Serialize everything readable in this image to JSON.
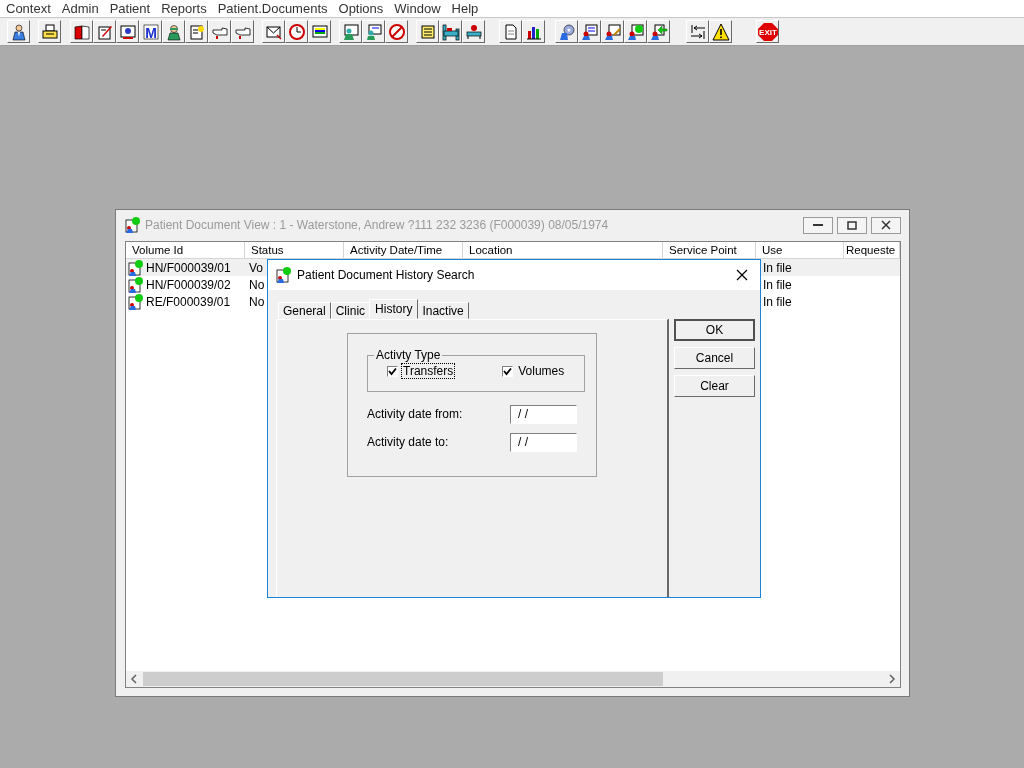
{
  "menu": [
    {
      "label": "Context"
    },
    {
      "label": "Admin"
    },
    {
      "label": "Patient"
    },
    {
      "label": "Reports"
    },
    {
      "label": "Patient.Documents"
    },
    {
      "label": "Options"
    },
    {
      "label": "Window"
    },
    {
      "label": "Help"
    }
  ],
  "toolbar": {
    "letter_label": "M",
    "exit_label": "EXIT"
  },
  "document_window": {
    "title": "Patient Document View : 1 - Waterstone, Andrew ?111 232 3236 (F000039) 08/05/1974",
    "columns": [
      "Volume Id",
      "Status",
      "Activity Date/Time",
      "Location",
      "Service Point",
      "Use",
      "Requeste"
    ],
    "rows": [
      {
        "volume_id": "HN/F000039/01",
        "status": "Vo",
        "use": "In file",
        "selected": true
      },
      {
        "volume_id": "HN/F000039/02",
        "status": "No",
        "use": "In file",
        "selected": false
      },
      {
        "volume_id": "RE/F000039/01",
        "status": "No",
        "use": "In file",
        "selected": false
      }
    ]
  },
  "dialog": {
    "title": "Patient Document History Search",
    "tabs": [
      {
        "label": "General",
        "selected": false
      },
      {
        "label": "Clinic",
        "selected": false
      },
      {
        "label": "History",
        "selected": true
      },
      {
        "label": "Inactive",
        "selected": false
      }
    ],
    "activity_type": {
      "legend": "Activty Type",
      "options": [
        {
          "label": "Transfers",
          "checked": true,
          "focused": true
        },
        {
          "label": "Volumes",
          "checked": true,
          "focused": false
        }
      ]
    },
    "fields": [
      {
        "label": "Activity date from:",
        "value": "/ /"
      },
      {
        "label": "Activity date to:",
        "value": "/ /"
      }
    ],
    "buttons": [
      {
        "label": "OK",
        "default": true
      },
      {
        "label": "Cancel",
        "default": false
      },
      {
        "label": "Clear",
        "default": false
      }
    ]
  }
}
